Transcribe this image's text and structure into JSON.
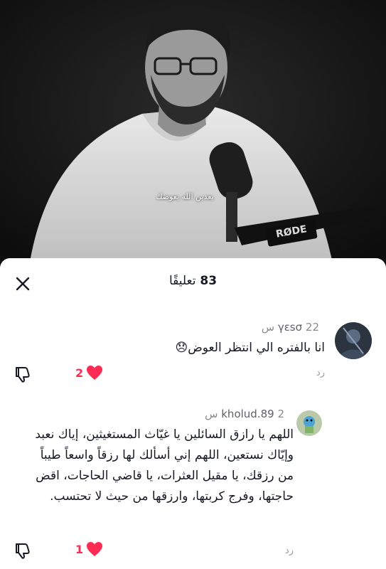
{
  "video": {
    "caption": "يعدين الله يعوضك",
    "mic_brand": "RØDE"
  },
  "comments_sheet": {
    "count": "83",
    "count_label": "تعليقًا"
  },
  "comments": [
    {
      "username": "γεsσ",
      "time": "22 س",
      "text": "انا بالفتره الي انتظر العوض😞",
      "likes": "2",
      "reply_label": "رد"
    },
    {
      "username": "kholud.89",
      "time": "2 س",
      "text": "اللهم يا رازق السائلين يا غيّاث المستغيثين، إياك نعبد وإيّاك نستعين، اللهم إني أسألك لها رزقاً واسعاً طيباً من رزقك، يا مقيل العثرات، يا قاضي الحاجات، اقض حاجتها، وفرج كربتها، وارزقها من حيث لا تحتسب.",
      "likes": "1",
      "reply_label": "رد"
    }
  ],
  "colors": {
    "like_red": "#fe2c55",
    "text_dark": "#161823",
    "muted": "#8a8b91"
  }
}
